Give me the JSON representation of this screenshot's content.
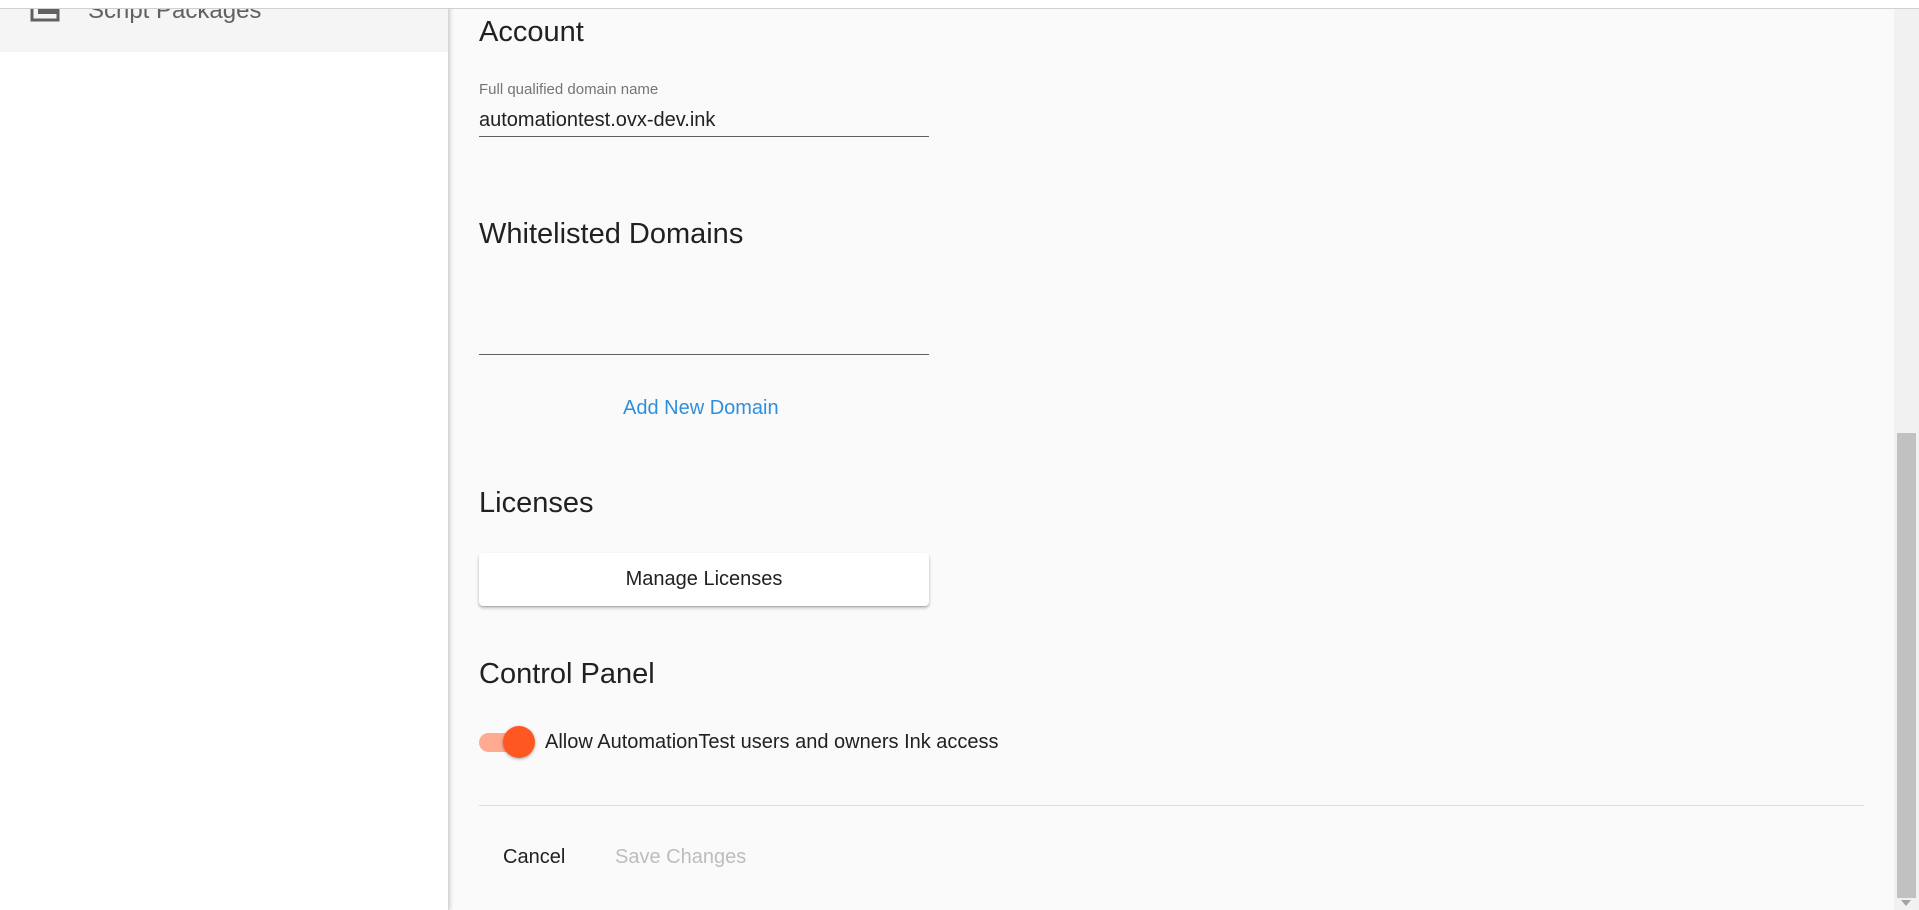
{
  "sidebar": {
    "items": [
      {
        "label": "Script Packages",
        "icon": "package-icon"
      }
    ]
  },
  "account": {
    "title": "Account",
    "fqdn_label": "Full qualified domain name",
    "fqdn_value": "automationtest.ovx-dev.ink"
  },
  "whitelist": {
    "title": "Whitelisted Domains",
    "input_value": "",
    "add_label": "Add New Domain"
  },
  "licenses": {
    "title": "Licenses",
    "manage_label": "Manage Licenses"
  },
  "control_panel": {
    "title": "Control Panel",
    "toggle_label": "Allow AutomationTest users and owners Ink access",
    "toggle_on": true
  },
  "actions": {
    "cancel_label": "Cancel",
    "save_label": "Save Changes"
  },
  "colors": {
    "accent": "#ff5722",
    "link": "#2f8fdc",
    "disabled": "#bdbdbd"
  }
}
